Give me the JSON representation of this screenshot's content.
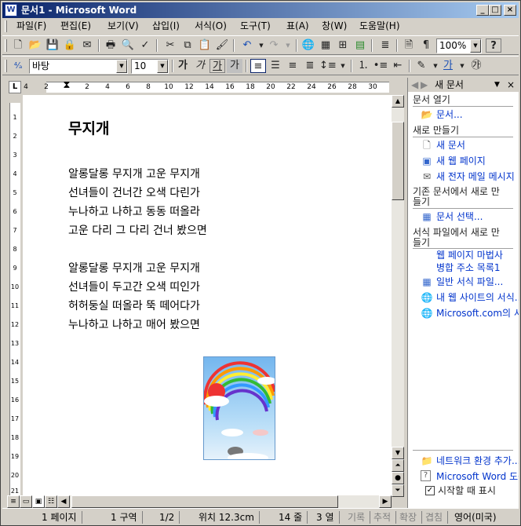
{
  "window": {
    "title": "문서1 - Microsoft Word",
    "app_icon": "W",
    "min": "_",
    "max": "□",
    "close": "×"
  },
  "menu": {
    "items": [
      "파일(F)",
      "편집(E)",
      "보기(V)",
      "삽입(I)",
      "서식(O)",
      "도구(T)",
      "표(A)",
      "창(W)",
      "도움말(H)"
    ]
  },
  "toolbar": {
    "zoom": "100%",
    "help": "?"
  },
  "format_bar": {
    "style": "",
    "font": "바탕",
    "size": "10",
    "bold": "가",
    "italic": "가",
    "underline": "가",
    "char_shade": "가"
  },
  "ruler": {
    "numbers": [
      "4",
      "2",
      "2",
      "4",
      "6",
      "8",
      "10",
      "12",
      "14",
      "16",
      "18",
      "20",
      "22",
      "24",
      "26",
      "28",
      "30"
    ],
    "vnumbers": [
      "1",
      "2",
      "3",
      "4",
      "5",
      "6",
      "7",
      "8",
      "9",
      "10",
      "11",
      "12",
      "13",
      "14",
      "15",
      "16",
      "17",
      "18",
      "19",
      "20",
      "21"
    ]
  },
  "document": {
    "title": "무지개",
    "stanza1": [
      "알롱달롱 무지개 고운 무지개",
      "선녀들이 건너간 오색 다린가",
      "누나하고 나하고 동동 떠올라",
      "고운 다리 그 다리 건너 봤으면"
    ],
    "stanza2": [
      "알롱달롱 무지개 고운 무지개",
      "선녀들이 두고간 오색 띠인가",
      "허허둥실 떠올라 뚝 떼어다가",
      "누나하고 나하고 매어 봤으면"
    ]
  },
  "taskpane": {
    "title": "새 문서",
    "section_open": "문서 열기",
    "open_doc": "문서...",
    "section_new": "새로 만들기",
    "new_doc": "새 문서",
    "new_web": "새 웹 페이지",
    "new_email": "새 전자 메일 메시지",
    "section_existing": "기존 문서에서 새로 만들기",
    "choose_doc": "문서 선택...",
    "section_template": "서식 파일에서 새로 만들기",
    "web_wizard": "웹 페이지 마법사",
    "merge": "병합 주소 목록1",
    "general_template": "일반 서식 파일...",
    "my_web": "내 웹 사이트의 서식...",
    "ms_com": "Microsoft.com의 서식...",
    "network": "네트워크 환경 추가...",
    "word_help": "Microsoft Word 도움말",
    "show_startup": "시작할 때 표시"
  },
  "status": {
    "page": "1 페이지",
    "section": "1 구역",
    "pages": "1/2",
    "pos": "위치 12.3cm",
    "line": "14 줄",
    "col": "3 열",
    "rec": "기록",
    "trk": "추적",
    "ext": "확장",
    "ovr": "겹침",
    "lang": "영어(미국)"
  }
}
